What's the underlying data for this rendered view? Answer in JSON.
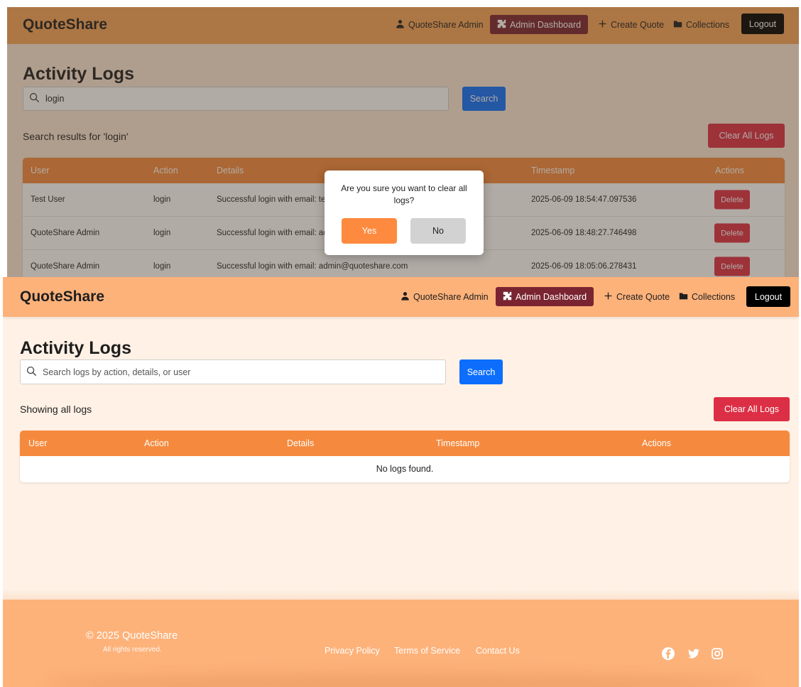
{
  "app": {
    "brand": "QuoteShare",
    "user_name": "QuoteShare Admin",
    "admin_dashboard": "Admin Dashboard",
    "create_quote": "Create Quote",
    "collections": "Collections",
    "logout": "Logout"
  },
  "colors": {
    "nav_orange": "#fdb27a",
    "table_header": "#f58a3e",
    "admin_pill": "#7a2431",
    "search_blue": "#0d6efd",
    "danger_red": "#dc2f45",
    "yes_orange": "#fd8a3e"
  },
  "icons": {
    "user": "user-icon",
    "dashboard": "puzzle-icon",
    "create": "plus-icon",
    "collections": "folder-icon",
    "search": "search-icon",
    "facebook": "facebook-icon",
    "twitter": "twitter-icon",
    "instagram": "instagram-icon"
  },
  "panel_search": {
    "title": "Activity Logs",
    "search_value": "login",
    "search_button": "Search",
    "status": "Search results for 'login'",
    "clear_button": "Clear All Logs",
    "columns": [
      "User",
      "Action",
      "Details",
      "Timestamp",
      "Actions"
    ],
    "rows": [
      {
        "user": "Test User",
        "action": "login",
        "details": "Successful login with email: tes",
        "timestamp": "2025-06-09 18:54:47.097536",
        "delete": "Delete"
      },
      {
        "user": "QuoteShare Admin",
        "action": "login",
        "details": "Successful login with email: adr",
        "timestamp": "2025-06-09 18:48:27.746498",
        "delete": "Delete"
      },
      {
        "user": "QuoteShare Admin",
        "action": "login",
        "details": "Successful login with email: admin@quoteshare.com",
        "timestamp": "2025-06-09 18:05:06.278431",
        "delete": "Delete"
      }
    ],
    "modal": {
      "message": "Are you sure you want to clear all logs?",
      "yes": "Yes",
      "no": "No"
    }
  },
  "panel_empty": {
    "title": "Activity Logs",
    "search_placeholder": "Search logs by action, details, or user",
    "search_button": "Search",
    "status": "Showing all logs",
    "clear_button": "Clear All Logs",
    "columns": [
      "User",
      "Action",
      "Details",
      "Timestamp",
      "Actions"
    ],
    "empty_message": "No logs found."
  },
  "footer": {
    "copyright": "© 2025 QuoteShare",
    "rights": "All rights reserved.",
    "links": [
      "Privacy Policy",
      "Terms of Service",
      "Contact Us"
    ]
  }
}
